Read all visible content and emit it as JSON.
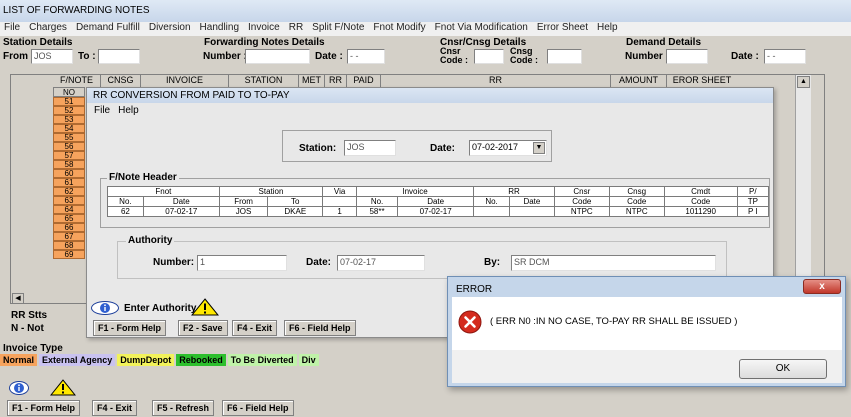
{
  "main": {
    "title": "LIST OF FORWARDING NOTES",
    "menu": [
      "File",
      "Charges",
      "Demand Fulfill",
      "Diversion",
      "Handling",
      "Invoice",
      "RR",
      "Split F/Note",
      "Fnot Modify",
      "Fnot Via Modification",
      "Error Sheet",
      "Help"
    ],
    "station_details": {
      "label": "Station Details",
      "from_label": "From :",
      "from_value": "JOS",
      "to_label": "To :"
    },
    "fwd_details": {
      "label": "Forwarding Notes Details",
      "number_label": "Number :",
      "date_label": "Date :",
      "date_value": "- -"
    },
    "cnsr_details": {
      "label": "Cnsr/Cnsg Details",
      "cnsr_code_label": "Cnsr Code :",
      "cnsg_code_label": "Cnsg Code :"
    },
    "demand_details": {
      "label": "Demand Details",
      "number_label": "Number :",
      "date_label": "Date :",
      "date_value": "- -"
    },
    "grid_headers": [
      "F/NOTE",
      "CNSG",
      "INVOICE",
      "STATION",
      "MET",
      "RR",
      "PAID",
      "RR",
      "AMOUNT",
      "EROR SHEET"
    ],
    "no_header": "NO",
    "row_numbers": [
      "51",
      "52",
      "53",
      "54",
      "55",
      "56",
      "57",
      "58",
      "60",
      "61",
      "62",
      "63",
      "64",
      "65",
      "66",
      "67",
      "68",
      "69"
    ],
    "rr_stts_label": "RR Stts",
    "n_not_label": "N - Not",
    "invoice_type_label": "Invoice Type",
    "invoice_types": [
      {
        "label": "Normal",
        "color": "#f6a35d"
      },
      {
        "label": "External Agency",
        "color": "#c9c2f0"
      },
      {
        "label": "DumpDepot",
        "color": "#f2f25a"
      },
      {
        "label": "Rebooked",
        "color": "#2dbf2d"
      },
      {
        "label": "To Be Diverted",
        "color": "#bff2a8"
      },
      {
        "label": "Div",
        "color": "#bff2a8"
      }
    ],
    "bottom_buttons": [
      "F1 - Form Help",
      "F4 - Exit",
      "F5 - Refresh",
      "F6 - Field Help"
    ]
  },
  "dialog": {
    "title": "RR CONVERSION FROM PAID TO TO-PAY",
    "menu": [
      "File",
      "Help"
    ],
    "station_label": "Station:",
    "station_value": "JOS",
    "date_label": "Date:",
    "date_value": "07-02-2017",
    "header_label": "F/Note Header",
    "table_group_headers": [
      "Fnot",
      "Station",
      "Via",
      "Invoice",
      "RR",
      "Cnsr",
      "Cnsg",
      "Cmdt",
      "P/"
    ],
    "table_sub_headers": [
      "No.",
      "Date",
      "From",
      "To",
      "",
      "No.",
      "Date",
      "No.",
      "Date",
      "Code",
      "Code",
      "Code",
      "TP"
    ],
    "table_row": [
      "62",
      "07-02-17",
      "JOS",
      "DKAE",
      "1",
      "58**",
      "07-02-17",
      "",
      "",
      "NTPC",
      "NTPC",
      "1011290",
      "P I"
    ],
    "authority_label": "Authority",
    "number_label": "Number:",
    "number_value": "1",
    "auth_date_label": "Date:",
    "auth_date_value": "07-02-17",
    "by_label": "By:",
    "by_value": "SR DCM",
    "status_text": "Enter Authority",
    "buttons": [
      "F1 - Form Help",
      "F2 - Save",
      "F4 - Exit",
      "F6 - Field Help"
    ]
  },
  "error": {
    "title": "ERROR",
    "message": "( ERR N0 :IN NO CASE, TO-PAY RR SHALL BE ISSUED )",
    "ok_label": "OK",
    "close_label": "x"
  }
}
